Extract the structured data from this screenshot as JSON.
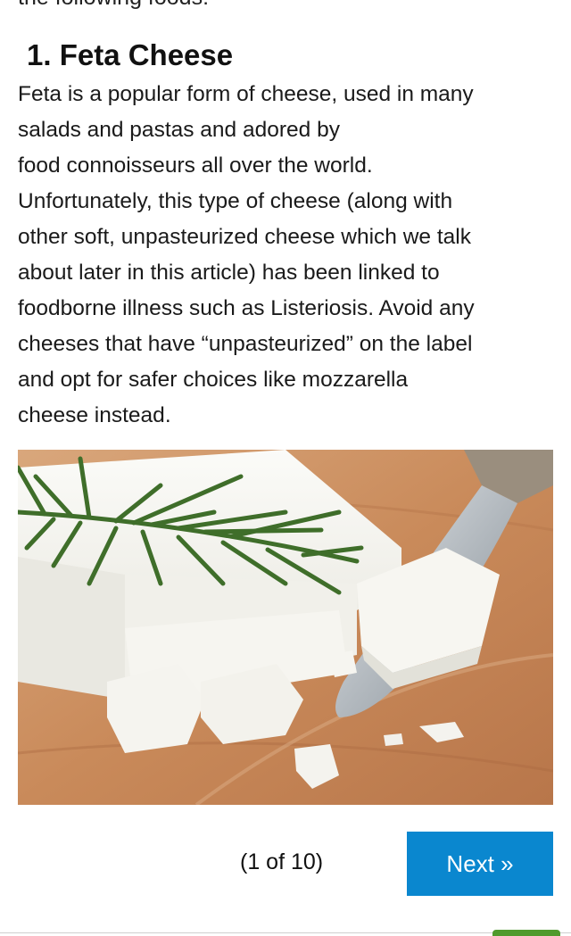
{
  "article": {
    "cut_off_text": "the following foods:",
    "heading": "1. Feta Cheese",
    "paragraph_lines": [
      "Feta is a popular form of cheese, used in many",
      "salads and pastas and adored by",
      "food connoisseurs all over the world.",
      "Unfortunately, this type of cheese (along with",
      "other soft, unpasteurized cheese which we talk",
      "about later in this article) has been linked to",
      "foodborne illness such as Listeriosis. Avoid any",
      "cheeses that have “unpasteurized” on the label",
      "and opt for safer choices like mozzarella",
      "cheese instead."
    ]
  },
  "image": {
    "subject": "feta-cheese-with-rosemary-and-knife"
  },
  "pagination": {
    "counter": "(1 of 10)",
    "next_label": "Next »"
  },
  "colors": {
    "next_button": "#0a87cf",
    "board_wood": "#c9895a",
    "cheese": "#f4f3ee",
    "rosemary": "#3f6e2a",
    "bottom_tab": "#4f9a2c"
  }
}
